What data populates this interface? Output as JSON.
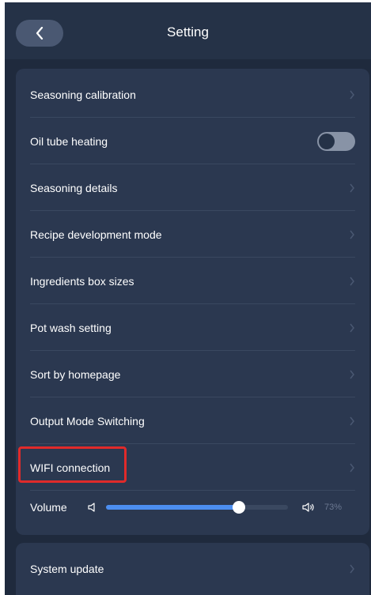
{
  "header": {
    "title": "Setting",
    "back_icon": "chevron-left-icon"
  },
  "settings": {
    "items": [
      {
        "label": "Seasoning calibration",
        "control": "chevron"
      },
      {
        "label": "Oil tube heating",
        "control": "toggle",
        "toggle_on": false
      },
      {
        "label": "Seasoning details",
        "control": "chevron"
      },
      {
        "label": "Recipe development mode",
        "control": "chevron"
      },
      {
        "label": "Ingredients box sizes",
        "control": "chevron"
      },
      {
        "label": "Pot wash setting",
        "control": "chevron"
      },
      {
        "label": "Sort by homepage",
        "control": "chevron"
      },
      {
        "label": "Output Mode Switching",
        "control": "chevron"
      },
      {
        "label": "WIFI connection",
        "control": "chevron",
        "highlighted": true
      }
    ],
    "volume": {
      "label": "Volume",
      "value": 73,
      "display": "73%",
      "low_icon": "speaker-low-icon",
      "high_icon": "speaker-high-icon"
    }
  },
  "system": {
    "items": [
      {
        "label": "System update",
        "control": "chevron"
      }
    ]
  },
  "colors": {
    "background": "#1f2a3d",
    "header": "#253247",
    "card": "#2b3850",
    "accent": "#4c8ef0",
    "highlight": "#e02a2a",
    "toggle_off": "#8893a6"
  }
}
